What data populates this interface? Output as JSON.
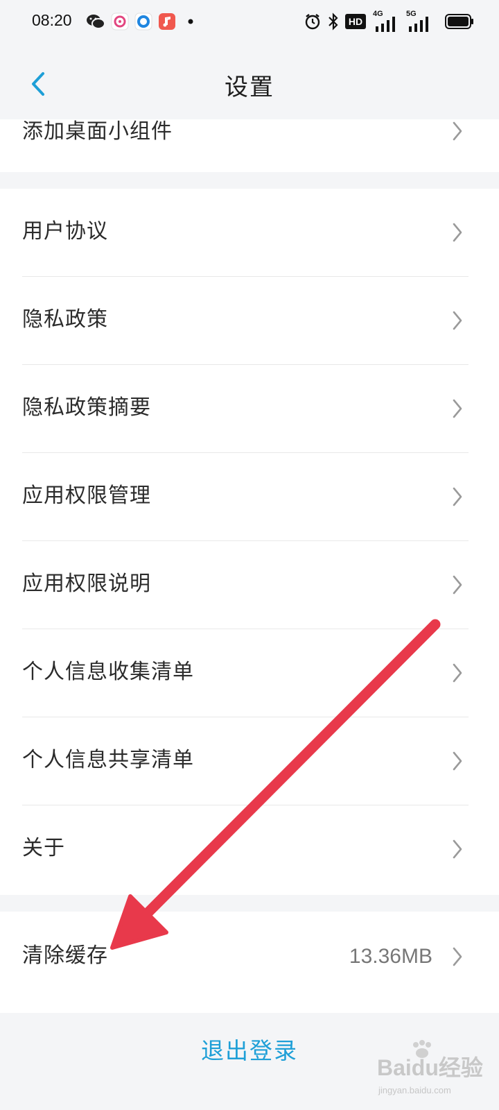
{
  "status_bar": {
    "time": "08:20",
    "notification_icons": [
      "wechat-icon",
      "camera-app-icon",
      "browser-app-icon",
      "music-app-icon",
      "more-dot-icon"
    ],
    "system_icons": [
      "alarm-icon",
      "bluetooth-icon",
      "hd-icon",
      "signal-4g-icon",
      "signal-5g-icon",
      "battery-icon"
    ],
    "hd_label": "HD",
    "network_4g": "4G",
    "network_5g": "5G"
  },
  "header": {
    "back_icon": "chevron-left-icon",
    "title": "设置"
  },
  "top_section": {
    "label": "添加桌面小组件"
  },
  "settings_list": [
    {
      "label": "用户协议"
    },
    {
      "label": "隐私政策"
    },
    {
      "label": "隐私政策摘要"
    },
    {
      "label": "应用权限管理"
    },
    {
      "label": "应用权限说明"
    },
    {
      "label": "个人信息收集清单"
    },
    {
      "label": "个人信息共享清单"
    },
    {
      "label": "关于"
    }
  ],
  "cache": {
    "label": "清除缓存",
    "value": "13.36MB"
  },
  "logout": {
    "label": "退出登录"
  },
  "watermark": {
    "main": "Baidu经验",
    "sub": "jingyan.baidu.com"
  },
  "colors": {
    "accent": "#1e9fd7",
    "annotation_arrow": "#e8394b",
    "background": "#f4f5f7",
    "card": "#ffffff"
  }
}
